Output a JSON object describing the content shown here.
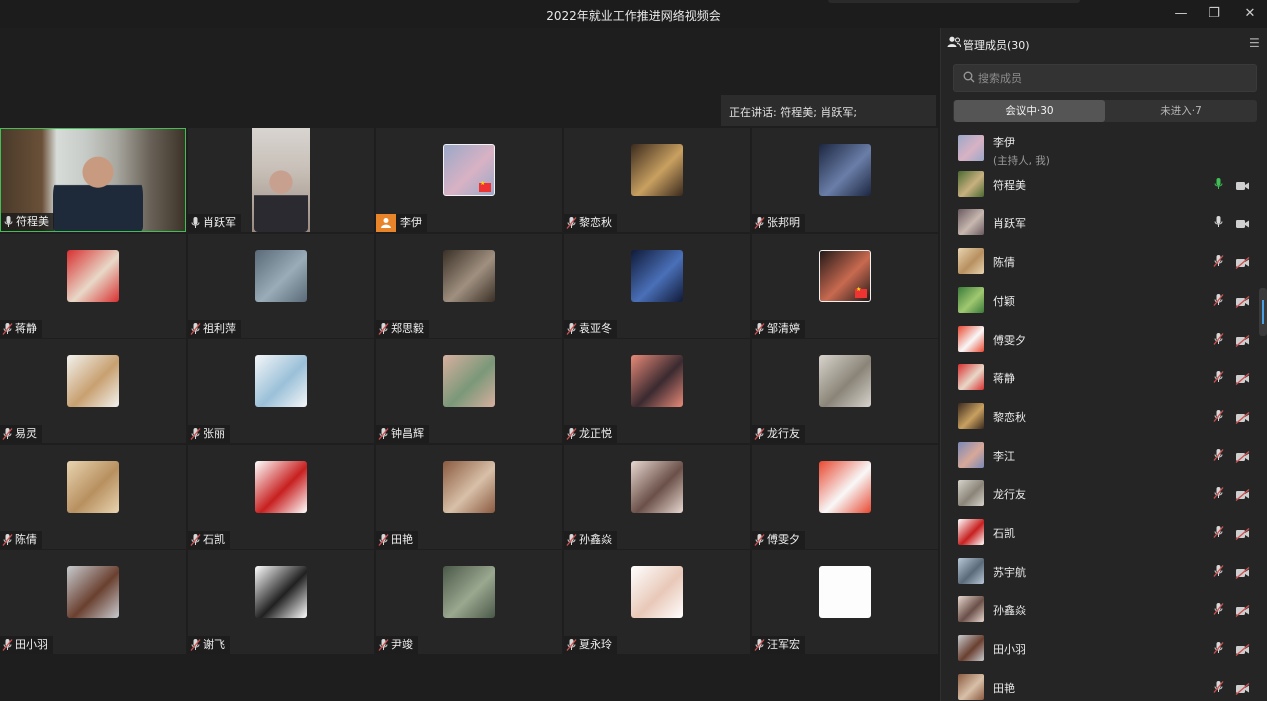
{
  "window": {
    "title": "2022年就业工作推进网络视频会",
    "min_glyph": "—",
    "max_glyph": "❐",
    "close_glyph": "✕"
  },
  "stage": {
    "speaking_label": "正在讲话: 符程美; 肖跃军;"
  },
  "grid": [
    {
      "name": "符程美",
      "mic": "on",
      "kind": "video-a",
      "active": true
    },
    {
      "name": "肖跃军",
      "mic": "on",
      "kind": "video-b"
    },
    {
      "name": "李伊",
      "mic": "host",
      "kind": "thumb",
      "colors": [
        "#9aa8c8",
        "#d8b2c4"
      ],
      "flag": true,
      "border": true
    },
    {
      "name": "黎恋秋",
      "mic": "off",
      "kind": "thumb",
      "colors": [
        "#3b2a1e",
        "#c8a060"
      ]
    },
    {
      "name": "张邦明",
      "mic": "off",
      "kind": "thumb",
      "colors": [
        "#1c2640",
        "#6a7ea8"
      ]
    },
    {
      "name": "蒋静",
      "mic": "off",
      "kind": "thumb",
      "colors": [
        "#d83030",
        "#e8d8c8"
      ]
    },
    {
      "name": "祖利萍",
      "mic": "off",
      "kind": "thumb",
      "colors": [
        "#5a6a78",
        "#9aacb8"
      ]
    },
    {
      "name": "郑思毅",
      "mic": "off",
      "kind": "thumb",
      "colors": [
        "#3a3026",
        "#a09080"
      ]
    },
    {
      "name": "袁亚冬",
      "mic": "off",
      "kind": "thumb",
      "colors": [
        "#101a38",
        "#4a70b8"
      ]
    },
    {
      "name": "邹清婷",
      "mic": "off",
      "kind": "thumb",
      "colors": [
        "#241a18",
        "#c86a50"
      ],
      "flag": true,
      "border": true
    },
    {
      "name": "易灵",
      "mic": "off",
      "kind": "thumb",
      "colors": [
        "#f2f2ee",
        "#c8a070"
      ]
    },
    {
      "name": "张丽",
      "mic": "off",
      "kind": "thumb",
      "colors": [
        "#f4f6f8",
        "#9ac0d8"
      ]
    },
    {
      "name": "钟昌辉",
      "mic": "off",
      "kind": "thumb",
      "colors": [
        "#d8b0a0",
        "#7a9878"
      ]
    },
    {
      "name": "龙正悦",
      "mic": "off",
      "kind": "thumb",
      "colors": [
        "#e88a78",
        "#3a2a30"
      ]
    },
    {
      "name": "龙行友",
      "mic": "off",
      "kind": "thumb",
      "colors": [
        "#d8d4cc",
        "#8a8478"
      ]
    },
    {
      "name": "陈倩",
      "mic": "off",
      "kind": "thumb",
      "colors": [
        "#e8d4b0",
        "#b89060"
      ]
    },
    {
      "name": "石凯",
      "mic": "off",
      "kind": "thumb",
      "colors": [
        "#ffffff",
        "#c82020"
      ]
    },
    {
      "name": "田艳",
      "mic": "off",
      "kind": "thumb",
      "colors": [
        "#8a5a40",
        "#d8c0a8"
      ]
    },
    {
      "name": "孙鑫焱",
      "mic": "off",
      "kind": "thumb",
      "colors": [
        "#e8d8d0",
        "#6a5048"
      ]
    },
    {
      "name": "傅雯夕",
      "mic": "off",
      "kind": "thumb",
      "colors": [
        "#e84830",
        "#f8f8f8"
      ]
    },
    {
      "name": "田小羽",
      "mic": "off",
      "kind": "thumb",
      "colors": [
        "#c8ccd0",
        "#6a4030"
      ]
    },
    {
      "name": "谢飞",
      "mic": "off",
      "kind": "thumb",
      "colors": [
        "#ffffff",
        "#202020"
      ]
    },
    {
      "name": "尹竣",
      "mic": "off",
      "kind": "thumb",
      "colors": [
        "#4a5848",
        "#9aa890"
      ]
    },
    {
      "name": "夏永玲",
      "mic": "off",
      "kind": "thumb",
      "colors": [
        "#ffffff",
        "#e8c8b8"
      ]
    },
    {
      "name": "汪军宏",
      "mic": "off",
      "kind": "thumb-blank",
      "colors": [
        "#ffffff",
        "#ffffff"
      ]
    }
  ],
  "panel": {
    "title": "管理成员(30)",
    "menu_glyph": "☰",
    "search_placeholder": "搜索成员",
    "tab_in": "会议中·30",
    "tab_out": "未进入·7",
    "members": [
      {
        "name": "李伊",
        "sub": "(主持人, 我)",
        "colors": [
          "#9aa8c8",
          "#d8b2c4"
        ],
        "mic": "none",
        "cam": "none"
      },
      {
        "name": "符程美",
        "colors": [
          "#4a6a30",
          "#c8b080"
        ],
        "mic": "on-green",
        "cam": "on"
      },
      {
        "name": "肖跃军",
        "colors": [
          "#6a5a60",
          "#c8b8b0"
        ],
        "mic": "on",
        "cam": "on"
      },
      {
        "name": "陈倩",
        "colors": [
          "#e8d4b0",
          "#b89060"
        ],
        "mic": "off",
        "cam": "off"
      },
      {
        "name": "付颖",
        "colors": [
          "#3a7a3a",
          "#a0c870"
        ],
        "mic": "off",
        "cam": "off"
      },
      {
        "name": "傅雯夕",
        "colors": [
          "#e84830",
          "#f8f8f8"
        ],
        "mic": "off",
        "cam": "off"
      },
      {
        "name": "蒋静",
        "colors": [
          "#d83030",
          "#e8d8c8"
        ],
        "mic": "off",
        "cam": "off"
      },
      {
        "name": "黎恋秋",
        "colors": [
          "#3b2a1e",
          "#c8a060"
        ],
        "mic": "off",
        "cam": "off"
      },
      {
        "name": "李江",
        "colors": [
          "#7a88b8",
          "#d8a898"
        ],
        "mic": "off",
        "cam": "off"
      },
      {
        "name": "龙行友",
        "colors": [
          "#d8d4cc",
          "#8a8478"
        ],
        "mic": "off",
        "cam": "off"
      },
      {
        "name": "石凯",
        "colors": [
          "#ffffff",
          "#c82020"
        ],
        "mic": "off",
        "cam": "off"
      },
      {
        "name": "苏宇航",
        "colors": [
          "#b8c8d8",
          "#5a6a78"
        ],
        "mic": "off",
        "cam": "off"
      },
      {
        "name": "孙鑫焱",
        "colors": [
          "#e8d8d0",
          "#6a5048"
        ],
        "mic": "off",
        "cam": "off"
      },
      {
        "name": "田小羽",
        "colors": [
          "#c8ccd0",
          "#6a4030"
        ],
        "mic": "off",
        "cam": "off"
      },
      {
        "name": "田艳",
        "colors": [
          "#8a5a40",
          "#d8c0a8"
        ],
        "mic": "off",
        "cam": "off"
      }
    ]
  },
  "colors": {
    "active_border": "#3fbf55",
    "host_badge": "#e8842a",
    "mic_muted": "#d05050",
    "mic_on": "#3fbf55"
  }
}
